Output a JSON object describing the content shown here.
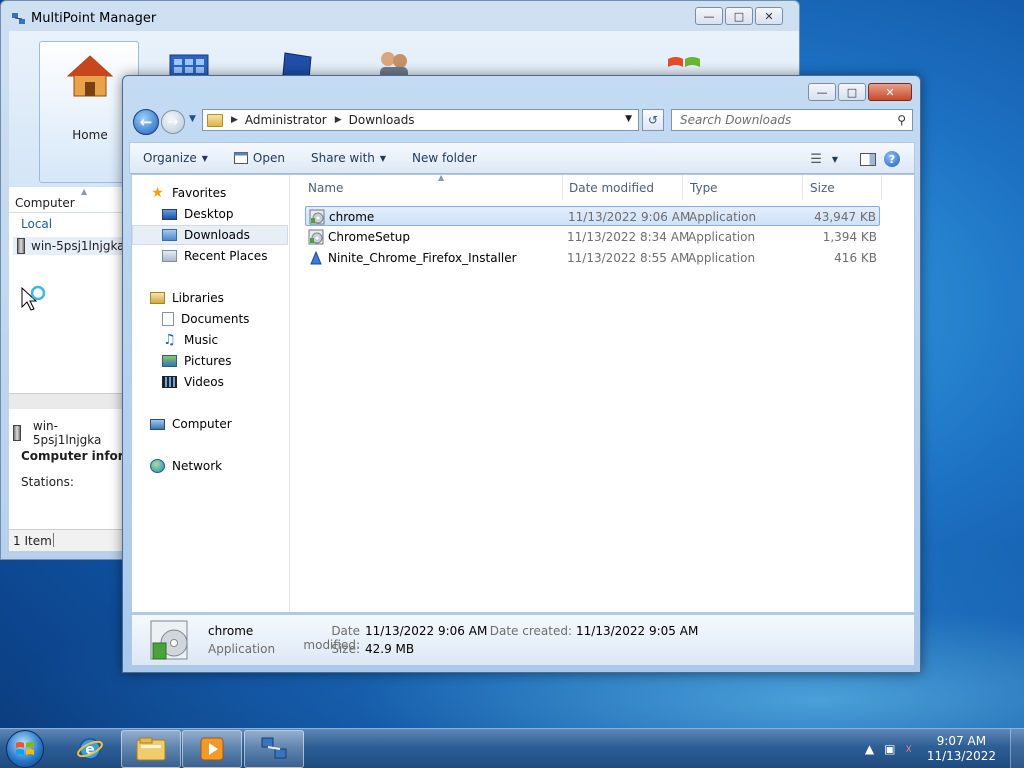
{
  "mpm": {
    "title": "MultiPoint Manager",
    "ribbon_home_label": "Home",
    "column_header": "Computer",
    "group_label": "Local",
    "computer_name": "win-5psj1lnjgka",
    "detail_computer_name": "win-5psj1lnjgka",
    "detail_title": "Computer information",
    "stations_label": "Stations:",
    "status_text": "1 Item"
  },
  "explorer": {
    "breadcrumb": [
      "Administrator",
      "Downloads"
    ],
    "search_placeholder": "Search Downloads",
    "toolbar": {
      "organize": "Organize",
      "open": "Open",
      "share_with": "Share with",
      "new_folder": "New folder"
    },
    "nav": {
      "favorites": "Favorites",
      "desktop": "Desktop",
      "downloads": "Downloads",
      "recent_places": "Recent Places",
      "libraries": "Libraries",
      "documents": "Documents",
      "music": "Music",
      "pictures": "Pictures",
      "videos": "Videos",
      "computer": "Computer",
      "network": "Network"
    },
    "columns": {
      "name": "Name",
      "date_modified": "Date modified",
      "type": "Type",
      "size": "Size"
    },
    "files": [
      {
        "name": "chrome",
        "date": "11/13/2022 9:06 AM",
        "type": "Application",
        "size": "43,947 KB",
        "selected": true
      },
      {
        "name": "ChromeSetup",
        "date": "11/13/2022 8:34 AM",
        "type": "Application",
        "size": "1,394 KB",
        "selected": false
      },
      {
        "name": "Ninite_Chrome_Firefox_Installer",
        "date": "11/13/2022 8:55 AM",
        "type": "Application",
        "size": "416 KB",
        "selected": false
      }
    ],
    "details": {
      "name": "chrome",
      "type": "Application",
      "date_modified_label": "Date modified:",
      "date_modified": "11/13/2022 9:06 AM",
      "date_created_label": "Date created:",
      "date_created": "11/13/2022 9:05 AM",
      "size_label": "Size:",
      "size": "42.9 MB"
    }
  },
  "taskbar": {
    "time": "9:07 AM",
    "date": "11/13/2022"
  },
  "icons": {
    "back": "back-arrow-icon",
    "forward": "forward-arrow-icon",
    "refresh": "refresh-icon",
    "search": "search-icon",
    "help": "help-icon"
  },
  "colors": {
    "selection": "#cfe1f8",
    "selection_border": "#84acdd",
    "window_frame": "#a8c8ec",
    "taskbar": "#2d5e95"
  }
}
